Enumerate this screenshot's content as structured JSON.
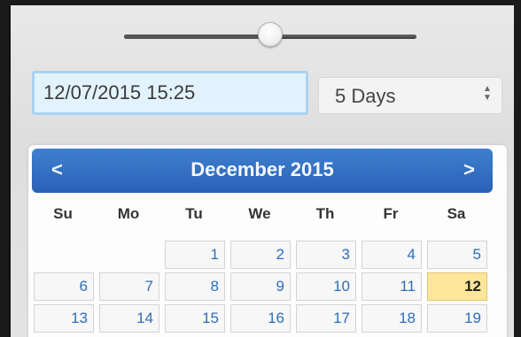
{
  "slider": {
    "value_fraction": 0.5
  },
  "date_input": {
    "value": "12/07/2015 15:25"
  },
  "range_select": {
    "value": "5 Days",
    "arrow_up": "▲",
    "arrow_down": "▼"
  },
  "calendar": {
    "title": "December 2015",
    "prev_label": "<",
    "next_label": ">",
    "weekdays": [
      "Su",
      "Mo",
      "Tu",
      "We",
      "Th",
      "Fr",
      "Sa"
    ],
    "weeks": [
      [
        "",
        "",
        "1",
        "2",
        "3",
        "4",
        "5"
      ],
      [
        "6",
        "7",
        "8",
        "9",
        "10",
        "11",
        "12"
      ],
      [
        "13",
        "14",
        "15",
        "16",
        "17",
        "18",
        "19"
      ]
    ],
    "highlighted_day": "12",
    "colors": {
      "header": "#2a61b6",
      "today": "#fbe69a",
      "day_text": "#2e6eb9"
    }
  }
}
